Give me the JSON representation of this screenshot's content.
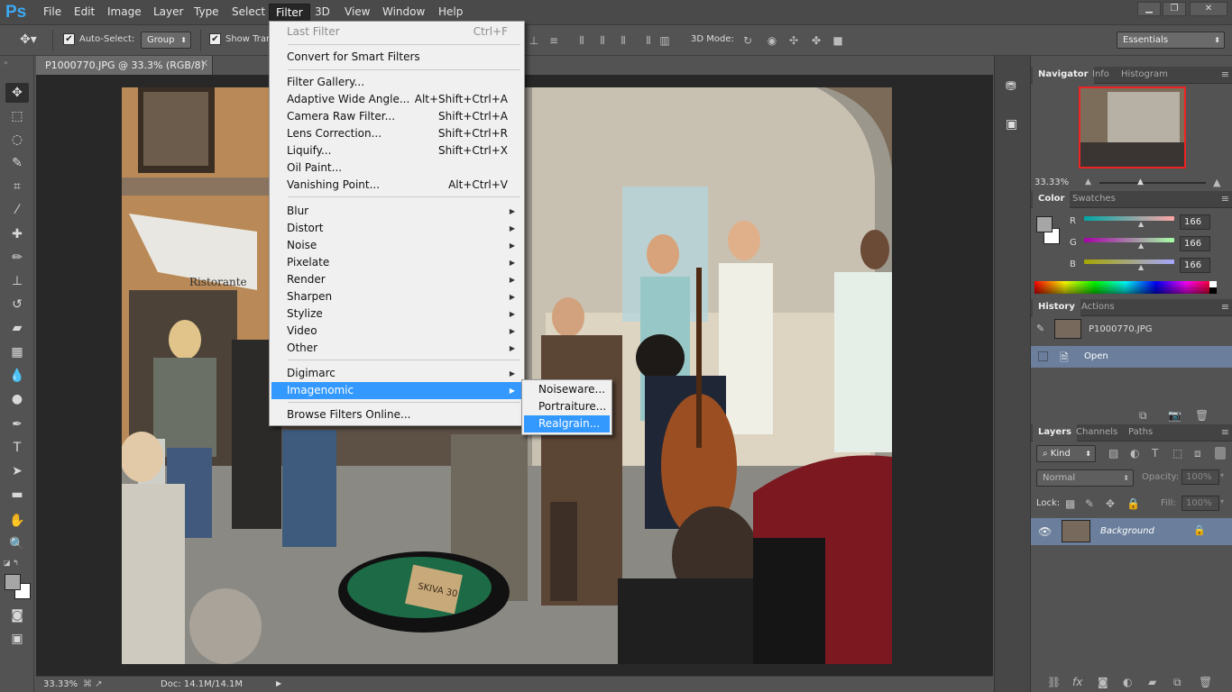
{
  "app": {
    "logo": "Ps"
  },
  "menubar": {
    "items": [
      "File",
      "Edit",
      "Image",
      "Layer",
      "Type",
      "Select",
      "Filter",
      "3D",
      "View",
      "Window",
      "Help"
    ],
    "window_controls": [
      "minimize-icon",
      "restore-icon",
      "close-icon"
    ]
  },
  "options": {
    "auto_select_label": "Auto-Select:",
    "auto_select_value": "Group",
    "show_transform_label": "Show Tran",
    "mode_3d_label": "3D Mode:",
    "workspace": "Essentials"
  },
  "document": {
    "tab_title": "P1000770.JPG @ 33.3% (RGB/8)",
    "zoom": "33.33%",
    "doc_size": "Doc: 14.1M/14.1M"
  },
  "filter_menu": {
    "last_filter": {
      "label": "Last Filter",
      "shortcut": "Ctrl+F"
    },
    "convert": "Convert for Smart Filters",
    "group1": [
      {
        "label": "Filter Gallery...",
        "shortcut": ""
      },
      {
        "label": "Adaptive Wide Angle...",
        "shortcut": "Alt+Shift+Ctrl+A"
      },
      {
        "label": "Camera Raw Filter...",
        "shortcut": "Shift+Ctrl+A"
      },
      {
        "label": "Lens Correction...",
        "shortcut": "Shift+Ctrl+R"
      },
      {
        "label": "Liquify...",
        "shortcut": "Shift+Ctrl+X"
      },
      {
        "label": "Oil Paint...",
        "shortcut": ""
      },
      {
        "label": "Vanishing Point...",
        "shortcut": "Alt+Ctrl+V"
      }
    ],
    "group2": [
      "Blur",
      "Distort",
      "Noise",
      "Pixelate",
      "Render",
      "Sharpen",
      "Stylize",
      "Video",
      "Other"
    ],
    "group3": [
      "Digimarc",
      "Imagenomic"
    ],
    "browse": "Browse Filters Online..."
  },
  "imagenomic_submenu": [
    "Noiseware...",
    "Portraiture...",
    "Realgrain..."
  ],
  "navigator": {
    "tabs": [
      "Navigator",
      "Info",
      "Histogram"
    ],
    "zoom": "33.33%"
  },
  "color": {
    "tabs": [
      "Color",
      "Swatches"
    ],
    "r_label": "R",
    "g_label": "G",
    "b_label": "B",
    "r": "166",
    "g": "166",
    "b": "166",
    "swatch": "#a6a6a6"
  },
  "history": {
    "tabs": [
      "History",
      "Actions"
    ],
    "snapshot": "P1000770.JPG",
    "states": [
      "Open"
    ]
  },
  "layers": {
    "tabs": [
      "Layers",
      "Channels",
      "Paths"
    ],
    "filter_kind": "Kind",
    "blend_mode": "Normal",
    "opacity_label": "Opacity:",
    "opacity": "100%",
    "lock_label": "Lock:",
    "fill_label": "Fill:",
    "fill": "100%",
    "layer_name": "Background"
  },
  "photo": {
    "awning_text": "Ristorante",
    "sign_text": "SKIVA 30"
  }
}
